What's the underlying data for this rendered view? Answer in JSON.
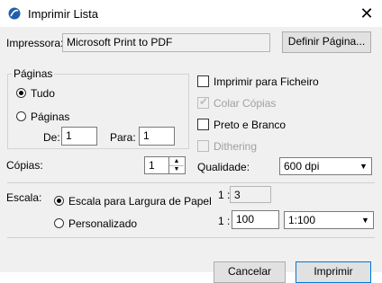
{
  "window": {
    "title": "Imprimir Lista",
    "close_icon": "close-icon"
  },
  "printer": {
    "label": "Impressora:",
    "value": "Microsoft Print to PDF",
    "define_button": "Definir Página..."
  },
  "pages": {
    "group_label": "Páginas",
    "all_label": "Tudo",
    "range_label": "Páginas",
    "from_label": "De:",
    "from_value": "1",
    "to_label": "Para:",
    "to_value": "1",
    "selected": "all"
  },
  "copies": {
    "label": "Cópias:",
    "value": "1"
  },
  "options": {
    "print_to_file": {
      "label": "Imprimir para Ficheiro",
      "checked": false
    },
    "collate": {
      "label": "Colar Cópias",
      "checked": true,
      "disabled": true
    },
    "black_white": {
      "label": "Preto e Branco",
      "checked": false
    },
    "dithering": {
      "label": "Dithering",
      "checked": false,
      "disabled": true
    }
  },
  "quality": {
    "label": "Qualidade:",
    "value": "600 dpi"
  },
  "scale": {
    "label": "Escala:",
    "fit_label": "Escala para Largura de Papel",
    "custom_label": "Personalizado",
    "selected": "fit",
    "ratio_prefix_1": "1 :",
    "ratio_value_1": "3",
    "ratio_prefix_2": "1 :",
    "ratio_value_2": "100",
    "ratio_select": "1:100"
  },
  "buttons": {
    "cancel": "Cancelar",
    "print": "Imprimir"
  }
}
